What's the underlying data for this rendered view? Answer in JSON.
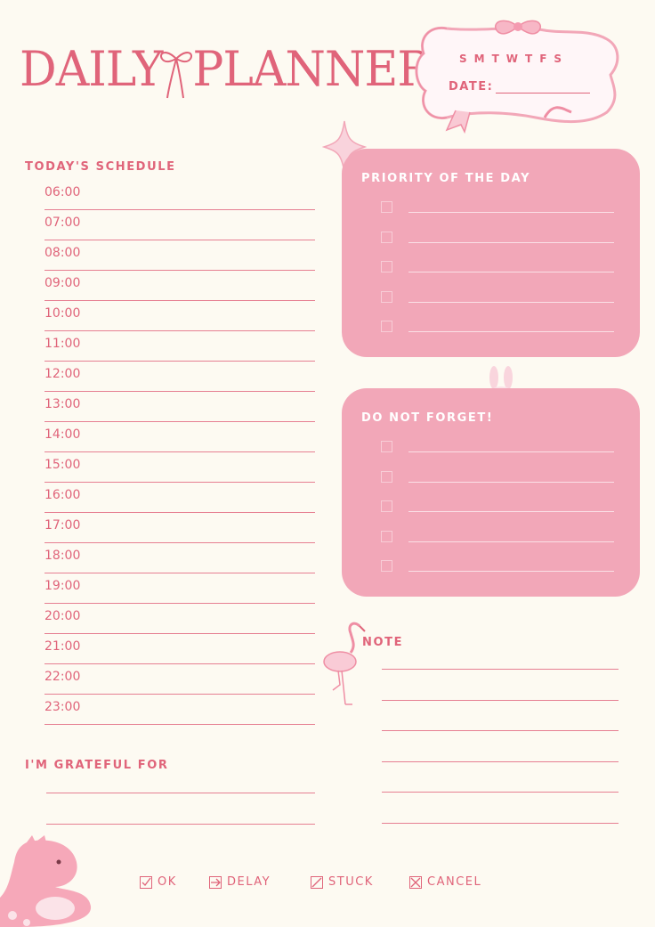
{
  "title": {
    "part1": "DAILY",
    "part2": "PLANNER"
  },
  "header": {
    "weekdays": "SMTWTFS",
    "date_label": "DATE:"
  },
  "schedule": {
    "heading": "TODAY'S SCHEDULE",
    "times": [
      "06:00",
      "07:00",
      "08:00",
      "09:00",
      "10:00",
      "11:00",
      "12:00",
      "13:00",
      "14:00",
      "15:00",
      "16:00",
      "17:00",
      "18:00",
      "19:00",
      "20:00",
      "21:00",
      "22:00",
      "23:00"
    ]
  },
  "priority": {
    "heading": "PRIORITY OF THE DAY",
    "count": 5
  },
  "forget": {
    "heading": "DO NOT FORGET!",
    "count": 5
  },
  "note": {
    "heading": "NOTE"
  },
  "grateful": {
    "heading": "I'M GRATEFUL FOR"
  },
  "legend": {
    "ok": "OK",
    "delay": "DELAY",
    "stuck": "STUCK",
    "cancel": "CANCEL"
  },
  "colors": {
    "accent": "#e0647a",
    "panel": "#f2a7b8",
    "background": "#fdfaf2"
  },
  "icons": [
    "bow-icon",
    "sparkle-icon",
    "bunny-icon",
    "flamingo-icon",
    "dinosaur-icon"
  ]
}
